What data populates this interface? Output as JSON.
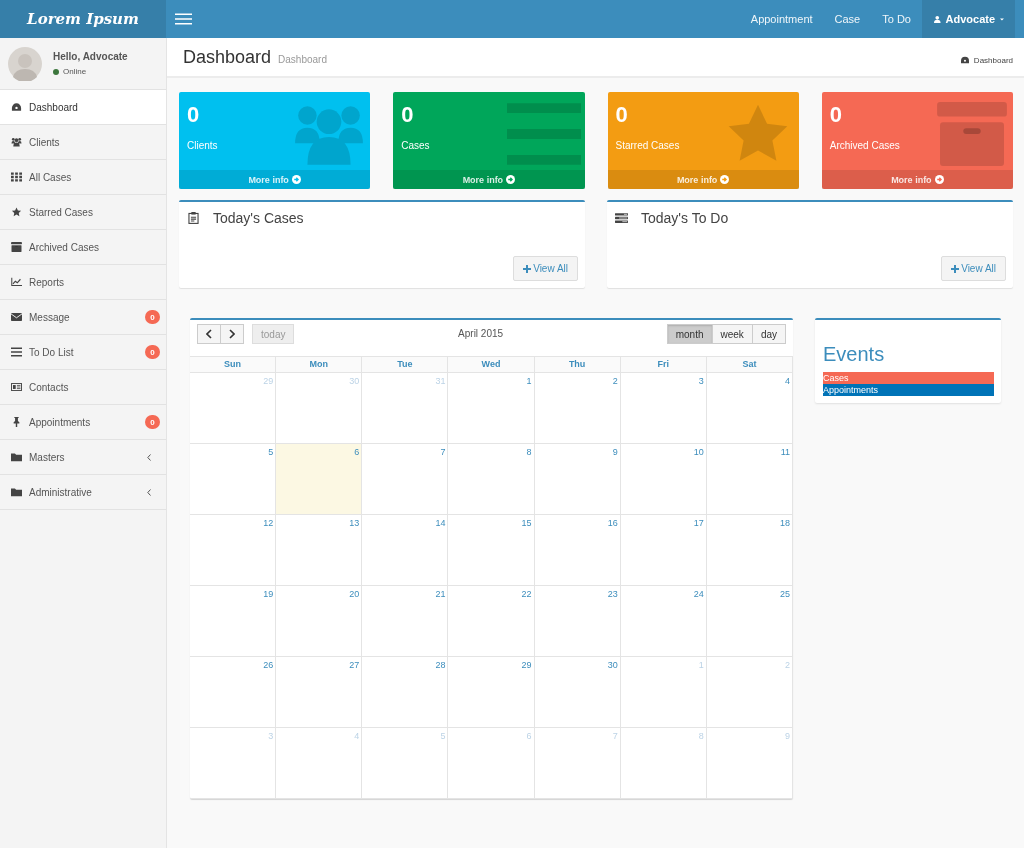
{
  "brand": "Lorem Ipsum",
  "nav_links": [
    "Appointment",
    "Case",
    "To Do"
  ],
  "user_menu": {
    "label": "Advocate"
  },
  "user_panel": {
    "greeting": "Hello, Advocate",
    "status": "Online",
    "online": true
  },
  "sidebar": {
    "items": [
      {
        "label": "Dashboard",
        "kind": "dashboard",
        "selected": true,
        "submenu": false
      },
      {
        "label": "Clients",
        "kind": "users",
        "selected": false,
        "submenu": false
      },
      {
        "label": "All Cases",
        "kind": "grid",
        "selected": false,
        "submenu": false
      },
      {
        "label": "Starred Cases",
        "kind": "star",
        "selected": false,
        "submenu": false
      },
      {
        "label": "Archived Cases",
        "kind": "archive",
        "selected": false,
        "submenu": false
      },
      {
        "label": "Reports",
        "kind": "chart",
        "selected": false,
        "submenu": false
      },
      {
        "label": "Message",
        "kind": "envelope",
        "selected": false,
        "submenu": false,
        "badge": "0"
      },
      {
        "label": "To Do List",
        "kind": "list",
        "selected": false,
        "submenu": false,
        "badge": "0"
      },
      {
        "label": "Contacts",
        "kind": "card",
        "selected": false,
        "submenu": false
      },
      {
        "label": "Appointments",
        "kind": "pin",
        "selected": false,
        "submenu": false,
        "badge": "0"
      },
      {
        "label": "Masters",
        "kind": "folder",
        "selected": false,
        "submenu": true
      },
      {
        "label": "Administrative",
        "kind": "folder",
        "selected": false,
        "submenu": true
      }
    ]
  },
  "page_header": {
    "title": "Dashboard",
    "subtitle": "Dashboard",
    "breadcrumb": "Dashboard"
  },
  "stat_boxes": [
    {
      "count": "0",
      "label": "Clients",
      "link": "More info",
      "kind": "users",
      "color": "#00c0ef"
    },
    {
      "count": "0",
      "label": "Cases",
      "link": "More info",
      "kind": "list",
      "color": "#00a65a"
    },
    {
      "count": "0",
      "label": "Starred Cases",
      "link": "More info",
      "kind": "star",
      "color": "#f39c12"
    },
    {
      "count": "0",
      "label": "Archived Cases",
      "link": "More info",
      "kind": "archive",
      "color": "#f56954"
    }
  ],
  "panels": [
    {
      "title": "Today's Cases",
      "kind": "clipboard",
      "button": "View All"
    },
    {
      "title": "Today's To Do",
      "kind": "tasks",
      "button": "View All"
    }
  ],
  "calendar": {
    "title": "April 2015",
    "today_button": "today",
    "views": [
      {
        "label": "month",
        "selected": true
      },
      {
        "label": "week",
        "selected": false
      },
      {
        "label": "day",
        "selected": false
      }
    ],
    "weekdays": [
      "Sun",
      "Mon",
      "Tue",
      "Wed",
      "Thu",
      "Fri",
      "Sat"
    ],
    "weeks": [
      [
        {
          "label": "29",
          "other_month": true,
          "today": false
        },
        {
          "label": "30",
          "other_month": true,
          "today": false
        },
        {
          "label": "31",
          "other_month": true,
          "today": false
        },
        {
          "label": "1",
          "other_month": false,
          "today": false
        },
        {
          "label": "2",
          "other_month": false,
          "today": false
        },
        {
          "label": "3",
          "other_month": false,
          "today": false
        },
        {
          "label": "4",
          "other_month": false,
          "today": false
        }
      ],
      [
        {
          "label": "5",
          "other_month": false,
          "today": false
        },
        {
          "label": "6",
          "other_month": false,
          "today": true
        },
        {
          "label": "7",
          "other_month": false,
          "today": false
        },
        {
          "label": "8",
          "other_month": false,
          "today": false
        },
        {
          "label": "9",
          "other_month": false,
          "today": false
        },
        {
          "label": "10",
          "other_month": false,
          "today": false
        },
        {
          "label": "11",
          "other_month": false,
          "today": false
        }
      ],
      [
        {
          "label": "12",
          "other_month": false,
          "today": false
        },
        {
          "label": "13",
          "other_month": false,
          "today": false
        },
        {
          "label": "14",
          "other_month": false,
          "today": false
        },
        {
          "label": "15",
          "other_month": false,
          "today": false
        },
        {
          "label": "16",
          "other_month": false,
          "today": false
        },
        {
          "label": "17",
          "other_month": false,
          "today": false
        },
        {
          "label": "18",
          "other_month": false,
          "today": false
        }
      ],
      [
        {
          "label": "19",
          "other_month": false,
          "today": false
        },
        {
          "label": "20",
          "other_month": false,
          "today": false
        },
        {
          "label": "21",
          "other_month": false,
          "today": false
        },
        {
          "label": "22",
          "other_month": false,
          "today": false
        },
        {
          "label": "23",
          "other_month": false,
          "today": false
        },
        {
          "label": "24",
          "other_month": false,
          "today": false
        },
        {
          "label": "25",
          "other_month": false,
          "today": false
        }
      ],
      [
        {
          "label": "26",
          "other_month": false,
          "today": false
        },
        {
          "label": "27",
          "other_month": false,
          "today": false
        },
        {
          "label": "28",
          "other_month": false,
          "today": false
        },
        {
          "label": "29",
          "other_month": false,
          "today": false
        },
        {
          "label": "30",
          "other_month": false,
          "today": false
        },
        {
          "label": "1",
          "other_month": true,
          "today": false
        },
        {
          "label": "2",
          "other_month": true,
          "today": false
        }
      ],
      [
        {
          "label": "3",
          "other_month": true,
          "today": false
        },
        {
          "label": "4",
          "other_month": true,
          "today": false
        },
        {
          "label": "5",
          "other_month": true,
          "today": false
        },
        {
          "label": "6",
          "other_month": true,
          "today": false
        },
        {
          "label": "7",
          "other_month": true,
          "today": false
        },
        {
          "label": "8",
          "other_month": true,
          "today": false
        },
        {
          "label": "9",
          "other_month": true,
          "today": false
        }
      ]
    ]
  },
  "events": {
    "title": "Events",
    "items": [
      {
        "label": "Cases",
        "color": "#f56954"
      },
      {
        "label": "Appointments",
        "color": "#0073b7"
      }
    ]
  }
}
